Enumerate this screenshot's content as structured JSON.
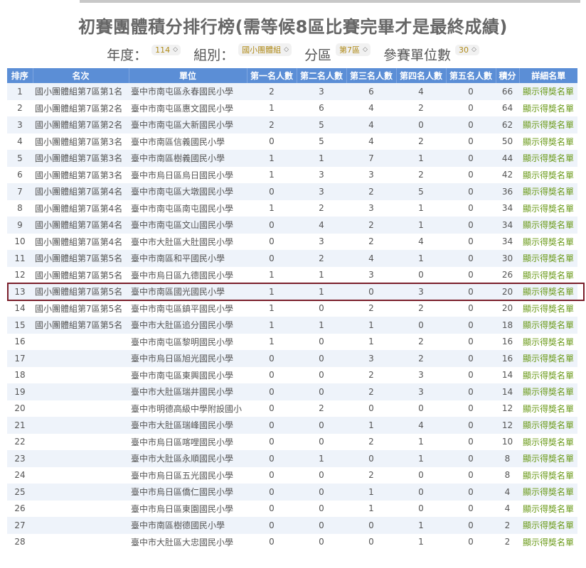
{
  "title": "初賽團體積分排行榜(需等候8區比賽完畢才是最終成績)",
  "filters": {
    "year_label": "年度：",
    "year_value": "114",
    "group_label": "組別：",
    "group_value": "國小團體組",
    "district_label": "分區",
    "district_value": "第7區",
    "units_label": "參賽單位數",
    "units_value": "30"
  },
  "table": {
    "headers": [
      "排序",
      "名次",
      "單位",
      "第一名人數",
      "第二名人數",
      "第三名人數",
      "第四名人數",
      "第五名人數",
      "積分",
      "詳細名單"
    ],
    "link_text": "顯示得獎名單",
    "highlight_row_index": 12,
    "rows": [
      {
        "no": "1",
        "rank": "國小團體組第7區第1名",
        "unit": "臺中市南屯區永春國民小學",
        "p1": "2",
        "p2": "3",
        "p3": "6",
        "p4": "4",
        "p5": "0",
        "score": "66"
      },
      {
        "no": "2",
        "rank": "國小團體組第7區第2名",
        "unit": "臺中市南屯區惠文國民小學",
        "p1": "1",
        "p2": "6",
        "p3": "4",
        "p4": "2",
        "p5": "0",
        "score": "64"
      },
      {
        "no": "3",
        "rank": "國小團體組第7區第2名",
        "unit": "臺中市南屯區大新國民小學",
        "p1": "2",
        "p2": "5",
        "p3": "4",
        "p4": "0",
        "p5": "0",
        "score": "62"
      },
      {
        "no": "4",
        "rank": "國小團體組第7區第3名",
        "unit": "臺中市南區信義國民小學",
        "p1": "0",
        "p2": "5",
        "p3": "4",
        "p4": "2",
        "p5": "0",
        "score": "50"
      },
      {
        "no": "5",
        "rank": "國小團體組第7區第3名",
        "unit": "臺中市南區樹義國民小學",
        "p1": "1",
        "p2": "1",
        "p3": "7",
        "p4": "1",
        "p5": "0",
        "score": "44"
      },
      {
        "no": "6",
        "rank": "國小團體組第7區第3名",
        "unit": "臺中市烏日區烏日國民小學",
        "p1": "1",
        "p2": "3",
        "p3": "3",
        "p4": "2",
        "p5": "0",
        "score": "42"
      },
      {
        "no": "7",
        "rank": "國小團體組第7區第4名",
        "unit": "臺中市南屯區大墩國民小學",
        "p1": "0",
        "p2": "3",
        "p3": "2",
        "p4": "5",
        "p5": "0",
        "score": "36"
      },
      {
        "no": "8",
        "rank": "國小團體組第7區第4名",
        "unit": "臺中市南屯區南屯國民小學",
        "p1": "1",
        "p2": "2",
        "p3": "3",
        "p4": "1",
        "p5": "0",
        "score": "34"
      },
      {
        "no": "9",
        "rank": "國小團體組第7區第4名",
        "unit": "臺中市南屯區文山國民小學",
        "p1": "0",
        "p2": "4",
        "p3": "2",
        "p4": "1",
        "p5": "0",
        "score": "34"
      },
      {
        "no": "10",
        "rank": "國小團體組第7區第4名",
        "unit": "臺中市大肚區大肚國民小學",
        "p1": "0",
        "p2": "3",
        "p3": "2",
        "p4": "4",
        "p5": "0",
        "score": "34"
      },
      {
        "no": "11",
        "rank": "國小團體組第7區第5名",
        "unit": "臺中市南區和平國民小學",
        "p1": "0",
        "p2": "2",
        "p3": "4",
        "p4": "1",
        "p5": "0",
        "score": "30"
      },
      {
        "no": "12",
        "rank": "國小團體組第7區第5名",
        "unit": "臺中市烏日區九德國民小學",
        "p1": "1",
        "p2": "1",
        "p3": "3",
        "p4": "0",
        "p5": "0",
        "score": "26"
      },
      {
        "no": "13",
        "rank": "國小團體組第7區第5名",
        "unit": "臺中市南區國光國民小學",
        "p1": "1",
        "p2": "1",
        "p3": "0",
        "p4": "3",
        "p5": "0",
        "score": "20"
      },
      {
        "no": "14",
        "rank": "國小團體組第7區第5名",
        "unit": "臺中市南屯區鎮平國民小學",
        "p1": "1",
        "p2": "0",
        "p3": "2",
        "p4": "2",
        "p5": "0",
        "score": "20"
      },
      {
        "no": "15",
        "rank": "國小團體組第7區第5名",
        "unit": "臺中市大肚區追分國民小學",
        "p1": "1",
        "p2": "1",
        "p3": "1",
        "p4": "0",
        "p5": "0",
        "score": "18"
      },
      {
        "no": "16",
        "rank": "",
        "unit": "臺中市南屯區黎明國民小學",
        "p1": "1",
        "p2": "0",
        "p3": "1",
        "p4": "2",
        "p5": "0",
        "score": "16"
      },
      {
        "no": "17",
        "rank": "",
        "unit": "臺中市烏日區旭光國民小學",
        "p1": "0",
        "p2": "0",
        "p3": "3",
        "p4": "2",
        "p5": "0",
        "score": "16"
      },
      {
        "no": "18",
        "rank": "",
        "unit": "臺中市南屯區東興國民小學",
        "p1": "0",
        "p2": "0",
        "p3": "2",
        "p4": "3",
        "p5": "0",
        "score": "14"
      },
      {
        "no": "19",
        "rank": "",
        "unit": "臺中市大肚區瑞井國民小學",
        "p1": "0",
        "p2": "0",
        "p3": "2",
        "p4": "3",
        "p5": "0",
        "score": "14"
      },
      {
        "no": "20",
        "rank": "",
        "unit": "臺中市明德高級中學附設國小",
        "p1": "0",
        "p2": "2",
        "p3": "0",
        "p4": "0",
        "p5": "0",
        "score": "12"
      },
      {
        "no": "21",
        "rank": "",
        "unit": "臺中市大肚區瑞峰國民小學",
        "p1": "0",
        "p2": "0",
        "p3": "1",
        "p4": "4",
        "p5": "0",
        "score": "12"
      },
      {
        "no": "22",
        "rank": "",
        "unit": "臺中市烏日區喀哩國民小學",
        "p1": "0",
        "p2": "0",
        "p3": "2",
        "p4": "1",
        "p5": "0",
        "score": "10"
      },
      {
        "no": "23",
        "rank": "",
        "unit": "臺中市大肚區永順國民小學",
        "p1": "0",
        "p2": "1",
        "p3": "0",
        "p4": "1",
        "p5": "0",
        "score": "8"
      },
      {
        "no": "24",
        "rank": "",
        "unit": "臺中市烏日區五光國民小學",
        "p1": "0",
        "p2": "0",
        "p3": "2",
        "p4": "0",
        "p5": "0",
        "score": "8"
      },
      {
        "no": "25",
        "rank": "",
        "unit": "臺中市烏日區僑仁國民小學",
        "p1": "0",
        "p2": "0",
        "p3": "1",
        "p4": "0",
        "p5": "0",
        "score": "4"
      },
      {
        "no": "26",
        "rank": "",
        "unit": "臺中市烏日區東園國民小學",
        "p1": "0",
        "p2": "0",
        "p3": "1",
        "p4": "0",
        "p5": "0",
        "score": "4"
      },
      {
        "no": "27",
        "rank": "",
        "unit": "臺中市南區樹德國民小學",
        "p1": "0",
        "p2": "0",
        "p3": "0",
        "p4": "1",
        "p5": "0",
        "score": "2"
      },
      {
        "no": "28",
        "rank": "",
        "unit": "臺中市大肚區大忠國民小學",
        "p1": "0",
        "p2": "0",
        "p3": "0",
        "p4": "1",
        "p5": "0",
        "score": "2"
      }
    ]
  },
  "colors": {
    "header_bg": "#5b8ed6",
    "link": "#6a9a18",
    "highlight_border": "#7a1e2a",
    "select_text": "#b08b1a"
  }
}
